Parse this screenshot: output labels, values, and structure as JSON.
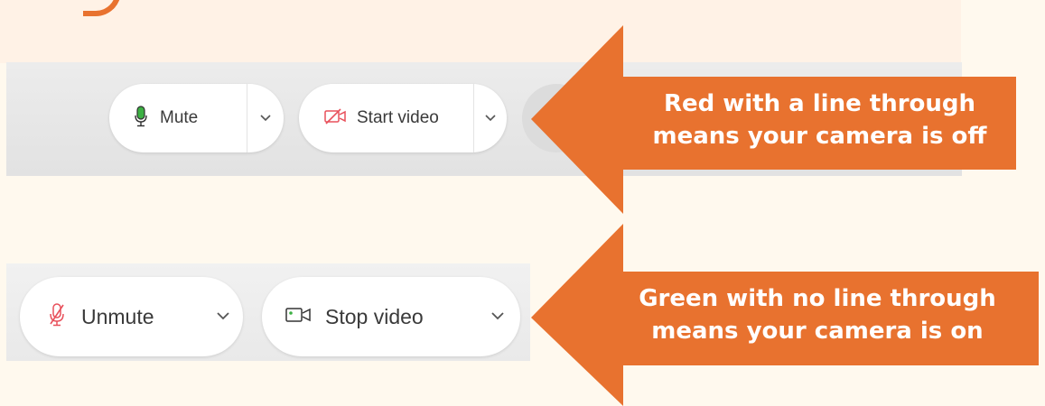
{
  "colors": {
    "background": "#fff9ee",
    "arrow": "#e8722f",
    "mic_green": "#3cb043",
    "mic_red": "#e8505b",
    "camera_red": "#e8505b",
    "camera_green": "#3cb043"
  },
  "top_toolbar": {
    "mute_label": "Mute",
    "start_video_label": "Start video",
    "mic_icon": "microphone-icon",
    "camera_icon": "camera-off-icon",
    "chevron_icon": "chevron-down-icon"
  },
  "bottom_toolbar": {
    "unmute_label": "Unmute",
    "stop_video_label": "Stop video",
    "mic_icon": "microphone-off-icon",
    "camera_icon": "camera-on-icon",
    "chevron_icon": "chevron-down-icon"
  },
  "callouts": {
    "off": {
      "line1": "Red with a line through",
      "line2": "means your camera is off"
    },
    "on": {
      "line1": "Green with no line through",
      "line2": "means your camera is on"
    }
  }
}
